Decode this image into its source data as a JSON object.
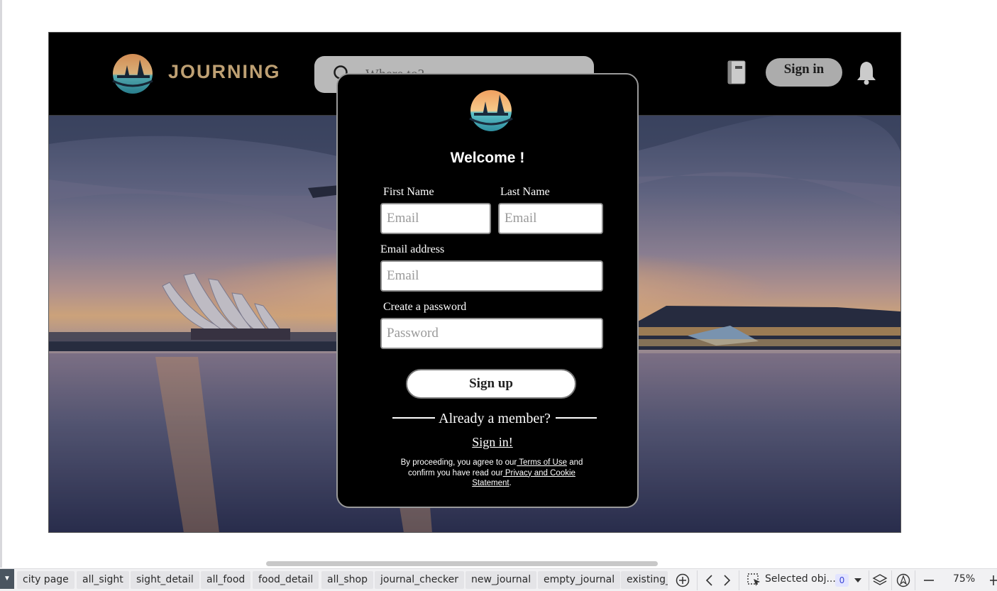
{
  "nav": {
    "brand": "JOURNING",
    "search_placeholder": "Where to?",
    "signin_label": "Sign in"
  },
  "modal": {
    "title": "Welcome !",
    "first_name_label": "First Name",
    "first_name_placeholder": "Email",
    "last_name_label": "Last Name",
    "last_name_placeholder": "Email",
    "email_label": "Email address",
    "email_placeholder": "Email",
    "password_label": "Create a password",
    "password_placeholder": "Password",
    "signup_label": "Sign up",
    "member_text": "Already a member?",
    "signin_link": "Sign in!",
    "legal": {
      "part1": "By proceeding, you agree to our",
      "terms": " Terms of Use",
      "part2": " and confirm you have read our",
      "privacy": " Privacy and Cookie Statement",
      "part3": "."
    }
  },
  "bottom_bar": {
    "tabs": [
      "city page",
      "all_sight",
      "sight_detail",
      "all_food",
      "food_detail",
      "all_shop",
      "journal_checker",
      "new_journal",
      "empty_journal",
      "existing_"
    ],
    "selected_label": "Selected obj...",
    "selected_count": "0",
    "zoom": "75%"
  },
  "colors": {
    "brand_gold": "#d9b783",
    "modal_bg": "#000000",
    "accent_blue": "#3b45d6"
  }
}
